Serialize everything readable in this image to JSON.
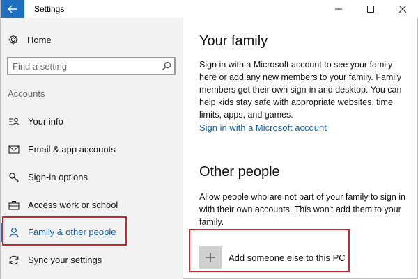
{
  "window": {
    "title": "Settings",
    "accent_color": "#1f6fc0",
    "highlight_color": "#d1232a"
  },
  "sidebar": {
    "home_label": "Home",
    "search_placeholder": "Find a setting",
    "section_title": "Accounts",
    "items": [
      {
        "label": "Your info",
        "icon": "contact-card-icon"
      },
      {
        "label": "Email & app accounts",
        "icon": "mail-icon"
      },
      {
        "label": "Sign-in options",
        "icon": "key-icon"
      },
      {
        "label": "Access work or school",
        "icon": "briefcase-icon"
      },
      {
        "label": "Family & other people",
        "icon": "person-icon",
        "selected": true
      },
      {
        "label": "Sync your settings",
        "icon": "sync-icon"
      }
    ]
  },
  "main": {
    "family": {
      "heading": "Your family",
      "description": "Sign in with a Microsoft account to see your family here or add any new members to your family. Family members get their own sign-in and desktop. You can help kids stay safe with appropriate websites, time limits, apps, and games.",
      "link": "Sign in with a Microsoft account"
    },
    "other_people": {
      "heading": "Other people",
      "description": "Allow people who are not part of your family to sign in with their own accounts. This won't add them to your family.",
      "add_label": "Add someone else to this PC"
    }
  }
}
